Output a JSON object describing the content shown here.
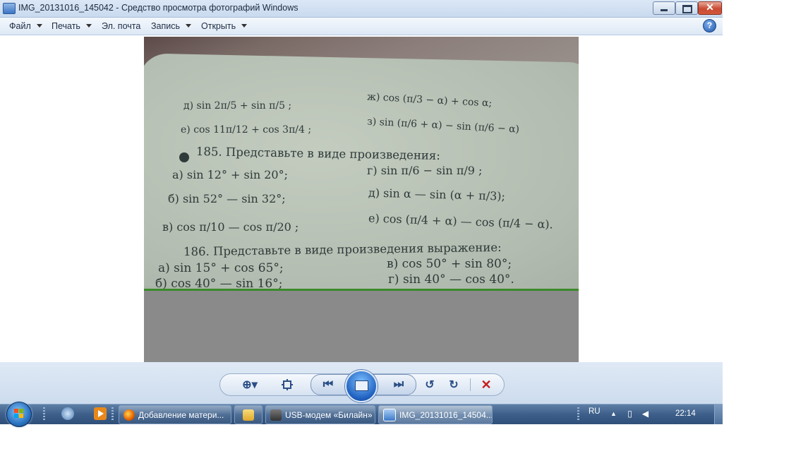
{
  "window": {
    "title": "IMG_20131016_145042 - Средство просмотра фотографий Windows",
    "controls": {
      "minimize": "minimize-icon",
      "maximize": "maximize-icon",
      "close": "✕"
    }
  },
  "menu": {
    "items": [
      {
        "label": "Файл",
        "dropdown": true
      },
      {
        "label": "Печать",
        "dropdown": true
      },
      {
        "label": "Эл. почта",
        "dropdown": false
      },
      {
        "label": "Запись",
        "dropdown": true
      },
      {
        "label": "Открыть",
        "dropdown": true
      }
    ],
    "help": "?"
  },
  "photo": {
    "lines": [
      "д) sin 2π/5 + sin π/5 ;",
      "ж) cos (π/3 − α) + cos α;",
      "е) cos 11π/12 + cos 3π/4 ;",
      "з) sin (π/6 + α) − sin (π/6 − α)",
      "185. Представьте в виде произведения:",
      "а) sin 12° + sin 20°;",
      "г) sin π/6 − sin π/9 ;",
      "б) sin 52° — sin 32°;",
      "д) sin α — sin (α + π/3);",
      "в) cos π/10 — cos π/20 ;",
      "е) cos (π/4 + α) — cos (π/4 − α).",
      "186. Представьте в виде произведения выражение:",
      "а) sin 15° + cos 65°;",
      "в) cos 50° + sin 80°;",
      "б) cos 40° — sin 16°;",
      "г) sin 40° — cos 40°."
    ]
  },
  "controls": {
    "zoom": "⊕▾",
    "fit": "fit-icon",
    "prev": "⏮",
    "next": "⏭",
    "rotate_ccw": "↺",
    "rotate_cw": "↻",
    "delete": "✕"
  },
  "taskbar": {
    "buttons": [
      {
        "label": "Добавление матери...",
        "active": false
      },
      {
        "label": "",
        "active": false
      },
      {
        "label": "USB-модем «Билайн»",
        "active": false
      },
      {
        "label": "IMG_20131016_14504...",
        "active": true
      }
    ],
    "lang": "RU",
    "clock": "22:14"
  },
  "colors": {
    "firefox": "#e66000",
    "folder": "#f0c64a",
    "media": "#e8881a",
    "modem": "#4a4a4a",
    "photo": "#3b79c9"
  }
}
